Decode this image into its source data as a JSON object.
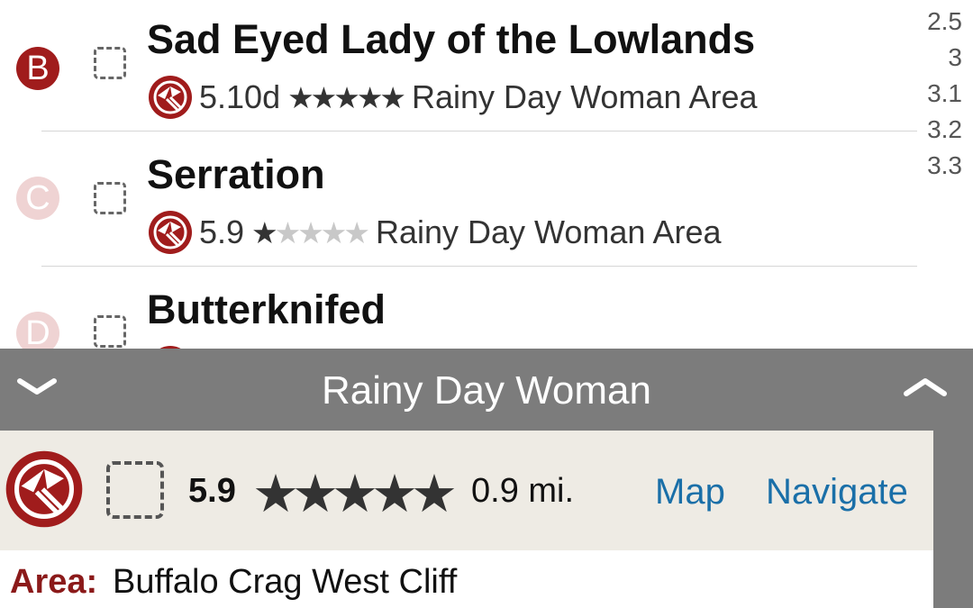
{
  "routes": [
    {
      "letter": "B",
      "name": "Sad Eyed Lady of the Lowlands",
      "grade": "5.10d",
      "stars": "★★★★★",
      "area": "Rainy Day Woman Area"
    },
    {
      "letter": "C",
      "name": "Serration",
      "grade": "5.9",
      "stars_on": "★",
      "stars_off": "★★★★",
      "area": "Rainy Day Woman Area"
    },
    {
      "letter": "D",
      "name": "Butterknifed"
    }
  ],
  "index": [
    "2.5",
    "3",
    "3.1",
    "3.2",
    "3.3"
  ],
  "area_bar": {
    "title": "Rainy Day Woman",
    "collapse_icon": "chevron-down-icon",
    "expand_icon": "chevron-up-icon"
  },
  "detail": {
    "grade": "5.9",
    "stars": "★★★★★",
    "distance": "0.9 mi.",
    "map_label": "Map",
    "navigate_label": "Navigate"
  },
  "info": {
    "area_label": "Area:",
    "area_value": "Buffalo Crag West Cliff"
  },
  "colors": {
    "brand_red": "#a01c1c",
    "link_blue": "#1a6fa8",
    "bar_gray": "#7c7c7c",
    "panel_beige": "#eeebe4"
  }
}
